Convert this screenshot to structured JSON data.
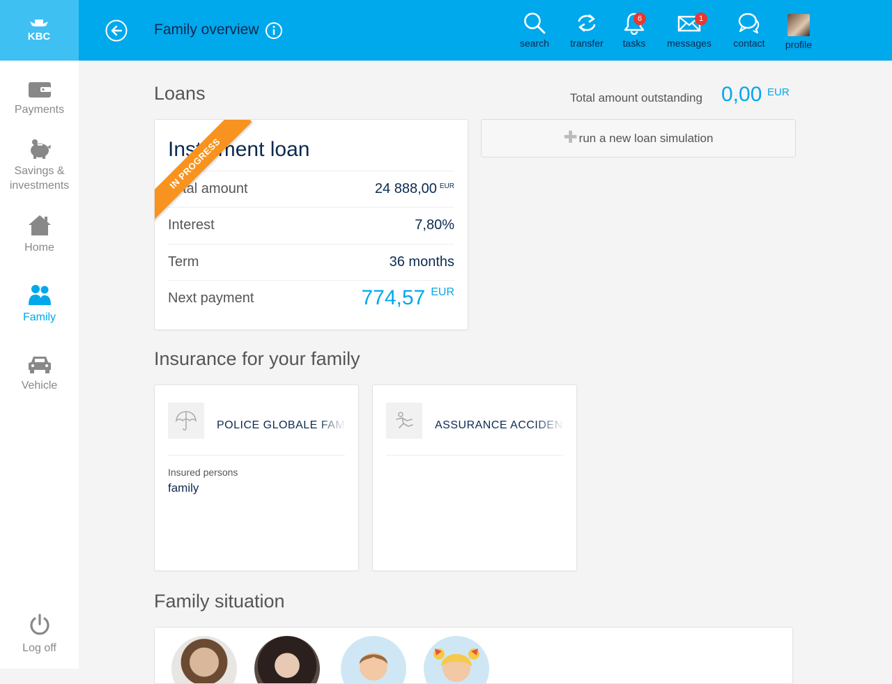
{
  "header": {
    "brand": "KBC",
    "title": "Family overview",
    "nav": [
      {
        "label": "search",
        "icon": "search-icon"
      },
      {
        "label": "transfer",
        "icon": "transfer-icon"
      },
      {
        "label": "tasks",
        "icon": "bell-icon",
        "badge": "6"
      },
      {
        "label": "messages",
        "icon": "envelope-icon",
        "badge": "1"
      },
      {
        "label": "contact",
        "icon": "chat-bubbles-icon"
      },
      {
        "label": "profile",
        "icon": "avatar"
      }
    ]
  },
  "sidebar": {
    "items": [
      {
        "label": "Payments",
        "icon": "wallet-icon"
      },
      {
        "label": "Savings & investments",
        "icon": "piggy-bank-icon"
      },
      {
        "label": "Home",
        "icon": "house-icon"
      },
      {
        "label": "Family",
        "icon": "family-icon",
        "active": true
      },
      {
        "label": "Vehicle",
        "icon": "car-icon"
      }
    ],
    "logoff": {
      "label": "Log off",
      "icon": "power-icon"
    }
  },
  "loans": {
    "section_title": "Loans",
    "total_label": "Total amount outstanding",
    "total_value": "0,00",
    "total_currency": "EUR",
    "simulation_button": "run a new loan simulation",
    "card": {
      "title": "Instalment loan",
      "status_ribbon": "IN PROGRESS",
      "rows": [
        {
          "label": "Total amount",
          "value": "24 888,00",
          "currency": "EUR"
        },
        {
          "label": "Interest",
          "value": "7,80%"
        },
        {
          "label": "Term",
          "value": "36 months"
        },
        {
          "label": "Next payment",
          "value": "774,57",
          "currency": "EUR"
        }
      ]
    }
  },
  "insurance": {
    "section_title": "Insurance for your family",
    "cards": [
      {
        "name": "POLICE GLOBALE FAMILIALE",
        "icon": "umbrella-icon",
        "sub_label": "Insured persons",
        "sub_value": "family"
      },
      {
        "name": "ASSURANCE ACCIDENTS",
        "icon": "falling-person-icon"
      }
    ]
  },
  "family": {
    "section_title": "Family situation"
  },
  "colors": {
    "brand_blue": "#00a8ec",
    "logo_blue": "#3fc0f2",
    "navy": "#0b2a50",
    "ribbon_orange": "#f7931e",
    "badge_red": "#e8382f"
  }
}
